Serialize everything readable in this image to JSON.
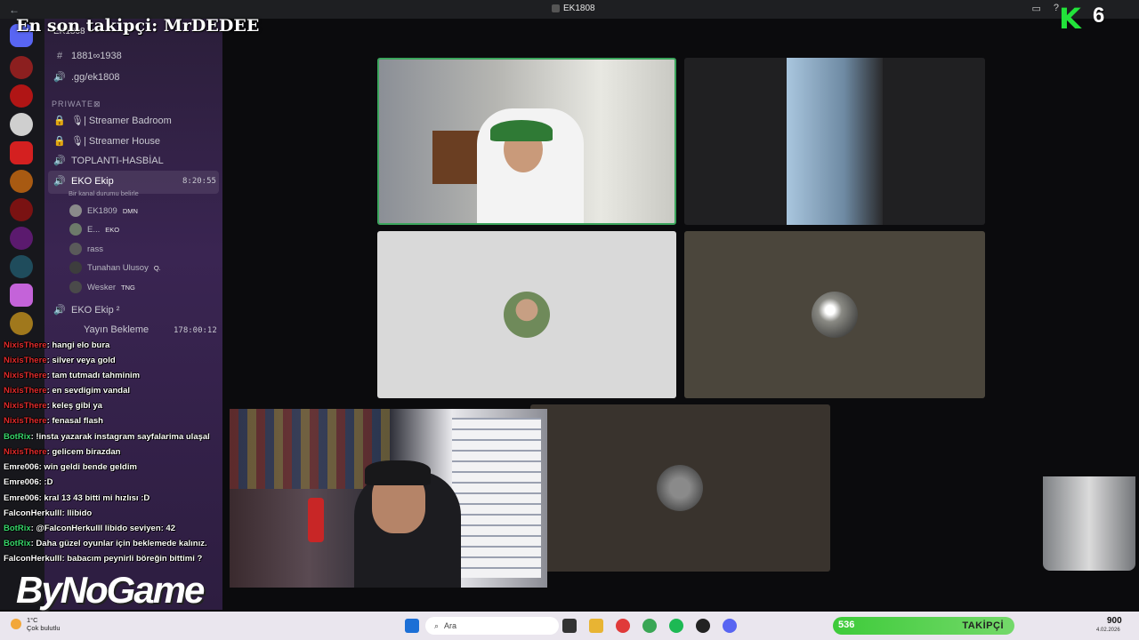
{
  "titlebar": {
    "title": "EK1808",
    "back": "←"
  },
  "overlay": {
    "follower_label": "En son takipçi: MrDEDEE",
    "k_count": "6"
  },
  "channels": {
    "server_name": "EK1808",
    "items": [
      {
        "icon": "#",
        "label": "1881∞1938"
      },
      {
        "icon": "🔊",
        "label": ".gg/ek1808"
      }
    ],
    "category": "PRIWATE⊠",
    "private": [
      {
        "icon": "🔒",
        "label": "🎙| Streamer Badroom"
      },
      {
        "icon": "🔒",
        "label": "🎙| Streamer House"
      },
      {
        "icon": "🔊",
        "label": "TOPLANTI-HASBİAL"
      },
      {
        "icon": "🔊",
        "label": "EKO Ekip"
      }
    ],
    "selected_status": "Bir kanal durumu belirle",
    "selected_timer": "8:20:55",
    "voice_users": [
      {
        "name": "EK1809",
        "tag": "DMN"
      },
      {
        "name": "E...",
        "tag": "EKO"
      },
      {
        "name": "rass",
        "tag": ""
      },
      {
        "name": "Tunahan Ulusoy",
        "tag": "Q."
      },
      {
        "name": "Wesker",
        "tag": "TNG"
      }
    ],
    "second": {
      "label": "EKO Ekip ²"
    },
    "waiting": {
      "label": "Yayın Bekleme",
      "timer": "178:00:12"
    }
  },
  "chat": [
    {
      "user": "NixisThere",
      "text": ": hangi elo bura",
      "color": "red"
    },
    {
      "user": "NixisThere",
      "text": ": silver veya gold",
      "color": "red"
    },
    {
      "user": "NixisThere",
      "text": ": tam tutmadı tahminim",
      "color": "red"
    },
    {
      "user": "NixisThere",
      "text": ": en sevdigim vandal",
      "color": "red"
    },
    {
      "user": "NixisThere",
      "text": ": keleş gibi ya",
      "color": "red"
    },
    {
      "user": "NixisThere",
      "text": ": fenasal flash",
      "color": "red"
    },
    {
      "user": "BotRix",
      "text": ": !insta yazarak instagram sayfalarima ulaşal",
      "color": "green"
    },
    {
      "user": "NixisThere",
      "text": ": gelicem birazdan",
      "color": "red"
    },
    {
      "user": "Emre006",
      "text": ": win geldi bende geldim",
      "color": "white"
    },
    {
      "user": "Emre006",
      "text": ": :D",
      "color": "white"
    },
    {
      "user": "Emre006",
      "text": ": kral 13 43 bitti mi hızlısı :D",
      "color": "white"
    },
    {
      "user": "FalconHerkulll",
      "text": ": llibido",
      "color": "white"
    },
    {
      "user": "BotRix",
      "text": ": @FalconHerkulll libido seviyen: 42",
      "color": "green"
    },
    {
      "user": "BotRix",
      "text": ": Daha güzel oyunlar için beklemede kalınız.",
      "color": "green"
    },
    {
      "user": "FalconHerkulll",
      "text": ": babacım peynirli böreğin bittimi ?",
      "color": "white"
    }
  ],
  "brand": "ByNoGame",
  "taskbar": {
    "weather_temp": "1°C",
    "weather_desc": "Çok bulutlu",
    "search_placeholder": "Ara",
    "followers": "536",
    "followers_label": "TAKİPÇİ",
    "total": "900",
    "date": "4.02.2026"
  },
  "colors": {
    "speaking_border": "#3ba55c",
    "chat_red": "#e02b2b",
    "kick_green": "#22e33a"
  }
}
